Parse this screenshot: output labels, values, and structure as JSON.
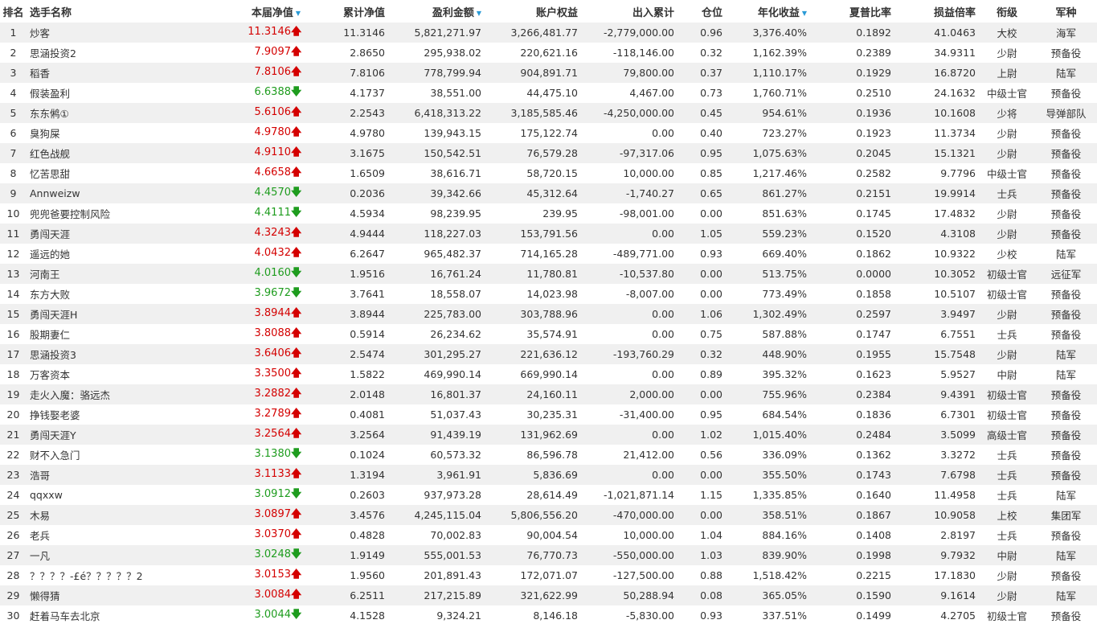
{
  "headers": {
    "rank": "排名",
    "name": "选手名称",
    "nav": "本届净值",
    "cum_nav": "累计净值",
    "profit": "盈利金额",
    "equity": "账户权益",
    "flow": "出入累计",
    "position": "仓位",
    "annual": "年化收益",
    "sharpe": "夏普比率",
    "pl_ratio": "损益倍率",
    "rank_title": "衔级",
    "branch": "军种"
  },
  "sort_indicator": "▼",
  "colors": {
    "up": "#d40000",
    "down": "#1e9c1e",
    "sort": "#2a9ad6",
    "stripe": "#f0f0f0"
  },
  "rows": [
    {
      "rank": "1",
      "name": "炒客",
      "nav": "11.3146",
      "dir": "up",
      "cum_nav": "11.3146",
      "profit": "5,821,271.97",
      "equity": "3,266,481.77",
      "flow": "-2,779,000.00",
      "position": "0.96",
      "annual": "3,376.40%",
      "sharpe": "0.1892",
      "pl_ratio": "41.0463",
      "title": "大校",
      "branch": "海军"
    },
    {
      "rank": "2",
      "name": "思涵投资2",
      "nav": "7.9097",
      "dir": "up",
      "cum_nav": "2.8650",
      "profit": "295,938.02",
      "equity": "220,621.16",
      "flow": "-118,146.00",
      "position": "0.32",
      "annual": "1,162.39%",
      "sharpe": "0.2389",
      "pl_ratio": "34.9311",
      "title": "少尉",
      "branch": "预备役"
    },
    {
      "rank": "3",
      "name": "稻香",
      "nav": "7.8106",
      "dir": "up",
      "cum_nav": "7.8106",
      "profit": "778,799.94",
      "equity": "904,891.71",
      "flow": "79,800.00",
      "position": "0.37",
      "annual": "1,110.17%",
      "sharpe": "0.1929",
      "pl_ratio": "16.8720",
      "title": "上尉",
      "branch": "陆军"
    },
    {
      "rank": "4",
      "name": "假装盈利",
      "nav": "6.6388",
      "dir": "down",
      "cum_nav": "4.1737",
      "profit": "38,551.00",
      "equity": "44,475.10",
      "flow": "4,467.00",
      "position": "0.73",
      "annual": "1,760.71%",
      "sharpe": "0.2510",
      "pl_ratio": "24.1632",
      "title": "中级士官",
      "branch": "预备役"
    },
    {
      "rank": "5",
      "name": "东东鸺①",
      "nav": "5.6106",
      "dir": "up",
      "cum_nav": "2.2543",
      "profit": "6,418,313.22",
      "equity": "3,185,585.46",
      "flow": "-4,250,000.00",
      "position": "0.45",
      "annual": "954.61%",
      "sharpe": "0.1936",
      "pl_ratio": "10.1608",
      "title": "少将",
      "branch": "导弹部队"
    },
    {
      "rank": "6",
      "name": "臭狗屎",
      "nav": "4.9780",
      "dir": "up",
      "cum_nav": "4.9780",
      "profit": "139,943.15",
      "equity": "175,122.74",
      "flow": "0.00",
      "position": "0.40",
      "annual": "723.27%",
      "sharpe": "0.1923",
      "pl_ratio": "11.3734",
      "title": "少尉",
      "branch": "预备役"
    },
    {
      "rank": "7",
      "name": "红色战舰",
      "nav": "4.9110",
      "dir": "up",
      "cum_nav": "3.1675",
      "profit": "150,542.51",
      "equity": "76,579.28",
      "flow": "-97,317.06",
      "position": "0.95",
      "annual": "1,075.63%",
      "sharpe": "0.2045",
      "pl_ratio": "15.1321",
      "title": "少尉",
      "branch": "预备役"
    },
    {
      "rank": "8",
      "name": "忆苦思甜",
      "nav": "4.6658",
      "dir": "up",
      "cum_nav": "1.6509",
      "profit": "38,616.71",
      "equity": "58,720.15",
      "flow": "10,000.00",
      "position": "0.85",
      "annual": "1,217.46%",
      "sharpe": "0.2582",
      "pl_ratio": "9.7796",
      "title": "中级士官",
      "branch": "预备役"
    },
    {
      "rank": "9",
      "name": "Annweizw",
      "nav": "4.4570",
      "dir": "down",
      "cum_nav": "0.2036",
      "profit": "39,342.66",
      "equity": "45,312.64",
      "flow": "-1,740.27",
      "position": "0.65",
      "annual": "861.27%",
      "sharpe": "0.2151",
      "pl_ratio": "19.9914",
      "title": "士兵",
      "branch": "预备役"
    },
    {
      "rank": "10",
      "name": "兜兜爸要控制风险",
      "nav": "4.4111",
      "dir": "down",
      "cum_nav": "4.5934",
      "profit": "98,239.95",
      "equity": "239.95",
      "flow": "-98,001.00",
      "position": "0.00",
      "annual": "851.63%",
      "sharpe": "0.1745",
      "pl_ratio": "17.4832",
      "title": "少尉",
      "branch": "预备役"
    },
    {
      "rank": "11",
      "name": "勇闯天涯",
      "nav": "4.3243",
      "dir": "up",
      "cum_nav": "4.9444",
      "profit": "118,227.03",
      "equity": "153,791.56",
      "flow": "0.00",
      "position": "1.05",
      "annual": "559.23%",
      "sharpe": "0.1520",
      "pl_ratio": "4.3108",
      "title": "少尉",
      "branch": "预备役"
    },
    {
      "rank": "12",
      "name": "遥远的她",
      "nav": "4.0432",
      "dir": "up",
      "cum_nav": "6.2647",
      "profit": "965,482.37",
      "equity": "714,165.28",
      "flow": "-489,771.00",
      "position": "0.93",
      "annual": "669.40%",
      "sharpe": "0.1862",
      "pl_ratio": "10.9322",
      "title": "少校",
      "branch": "陆军"
    },
    {
      "rank": "13",
      "name": "河南王",
      "nav": "4.0160",
      "dir": "down",
      "cum_nav": "1.9516",
      "profit": "16,761.24",
      "equity": "11,780.81",
      "flow": "-10,537.80",
      "position": "0.00",
      "annual": "513.75%",
      "sharpe": "0.0000",
      "pl_ratio": "10.3052",
      "title": "初级士官",
      "branch": "远征军"
    },
    {
      "rank": "14",
      "name": "东方大败",
      "nav": "3.9672",
      "dir": "down",
      "cum_nav": "3.7641",
      "profit": "18,558.07",
      "equity": "14,023.98",
      "flow": "-8,007.00",
      "position": "0.00",
      "annual": "773.49%",
      "sharpe": "0.1858",
      "pl_ratio": "10.5107",
      "title": "初级士官",
      "branch": "预备役"
    },
    {
      "rank": "15",
      "name": "勇闯天涯H",
      "nav": "3.8944",
      "dir": "up",
      "cum_nav": "3.8944",
      "profit": "225,783.00",
      "equity": "303,788.96",
      "flow": "0.00",
      "position": "1.06",
      "annual": "1,302.49%",
      "sharpe": "0.2597",
      "pl_ratio": "3.9497",
      "title": "少尉",
      "branch": "预备役"
    },
    {
      "rank": "16",
      "name": "股期妻仁",
      "nav": "3.8088",
      "dir": "up",
      "cum_nav": "0.5914",
      "profit": "26,234.62",
      "equity": "35,574.91",
      "flow": "0.00",
      "position": "0.75",
      "annual": "587.88%",
      "sharpe": "0.1747",
      "pl_ratio": "6.7551",
      "title": "士兵",
      "branch": "预备役"
    },
    {
      "rank": "17",
      "name": "思涵投资3",
      "nav": "3.6406",
      "dir": "up",
      "cum_nav": "2.5474",
      "profit": "301,295.27",
      "equity": "221,636.12",
      "flow": "-193,760.29",
      "position": "0.32",
      "annual": "448.90%",
      "sharpe": "0.1955",
      "pl_ratio": "15.7548",
      "title": "少尉",
      "branch": "陆军"
    },
    {
      "rank": "18",
      "name": "万客资本",
      "nav": "3.3500",
      "dir": "up",
      "cum_nav": "1.5822",
      "profit": "469,990.14",
      "equity": "669,990.14",
      "flow": "0.00",
      "position": "0.89",
      "annual": "395.32%",
      "sharpe": "0.1623",
      "pl_ratio": "5.9527",
      "title": "中尉",
      "branch": "陆军"
    },
    {
      "rank": "19",
      "name": "走火入魔：骆远杰",
      "nav": "3.2882",
      "dir": "up",
      "cum_nav": "2.0148",
      "profit": "16,801.37",
      "equity": "24,160.11",
      "flow": "2,000.00",
      "position": "0.00",
      "annual": "755.96%",
      "sharpe": "0.2384",
      "pl_ratio": "9.4391",
      "title": "初级士官",
      "branch": "预备役"
    },
    {
      "rank": "20",
      "name": "挣钱娶老婆",
      "nav": "3.2789",
      "dir": "up",
      "cum_nav": "0.4081",
      "profit": "51,037.43",
      "equity": "30,235.31",
      "flow": "-31,400.00",
      "position": "0.95",
      "annual": "684.54%",
      "sharpe": "0.1836",
      "pl_ratio": "6.7301",
      "title": "初级士官",
      "branch": "预备役"
    },
    {
      "rank": "21",
      "name": "勇闯天涯Y",
      "nav": "3.2564",
      "dir": "up",
      "cum_nav": "3.2564",
      "profit": "91,439.19",
      "equity": "131,962.69",
      "flow": "0.00",
      "position": "1.02",
      "annual": "1,015.40%",
      "sharpe": "0.2484",
      "pl_ratio": "3.5099",
      "title": "高级士官",
      "branch": "预备役"
    },
    {
      "rank": "22",
      "name": "财不入急门",
      "nav": "3.1380",
      "dir": "down",
      "cum_nav": "0.1024",
      "profit": "60,573.32",
      "equity": "86,596.78",
      "flow": "21,412.00",
      "position": "0.56",
      "annual": "336.09%",
      "sharpe": "0.1362",
      "pl_ratio": "3.3272",
      "title": "士兵",
      "branch": "预备役"
    },
    {
      "rank": "23",
      "name": "浩哥",
      "nav": "3.1133",
      "dir": "up",
      "cum_nav": "1.3194",
      "profit": "3,961.91",
      "equity": "5,836.69",
      "flow": "0.00",
      "position": "0.00",
      "annual": "355.50%",
      "sharpe": "0.1743",
      "pl_ratio": "7.6798",
      "title": "士兵",
      "branch": "预备役"
    },
    {
      "rank": "24",
      "name": "qqxxw",
      "nav": "3.0912",
      "dir": "down",
      "cum_nav": "0.2603",
      "profit": "937,973.28",
      "equity": "28,614.49",
      "flow": "-1,021,871.14",
      "position": "1.15",
      "annual": "1,335.85%",
      "sharpe": "0.1640",
      "pl_ratio": "11.4958",
      "title": "士兵",
      "branch": "陆军"
    },
    {
      "rank": "25",
      "name": "木易",
      "nav": "3.0897",
      "dir": "up",
      "cum_nav": "3.4576",
      "profit": "4,245,115.04",
      "equity": "5,806,556.20",
      "flow": "-470,000.00",
      "position": "0.00",
      "annual": "358.51%",
      "sharpe": "0.1867",
      "pl_ratio": "10.9058",
      "title": "上校",
      "branch": "集团军"
    },
    {
      "rank": "26",
      "name": "老兵",
      "nav": "3.0370",
      "dir": "up",
      "cum_nav": "0.4828",
      "profit": "70,002.83",
      "equity": "90,004.54",
      "flow": "10,000.00",
      "position": "1.04",
      "annual": "884.16%",
      "sharpe": "0.1408",
      "pl_ratio": "2.8197",
      "title": "士兵",
      "branch": "预备役"
    },
    {
      "rank": "27",
      "name": "一凡",
      "nav": "3.0248",
      "dir": "down",
      "cum_nav": "1.9149",
      "profit": "555,001.53",
      "equity": "76,770.73",
      "flow": "-550,000.00",
      "position": "1.03",
      "annual": "839.90%",
      "sharpe": "0.1998",
      "pl_ratio": "9.7932",
      "title": "中尉",
      "branch": "陆军"
    },
    {
      "rank": "28",
      "name": "？？？？-£é？？？？？2",
      "nav": "3.0153",
      "dir": "up",
      "cum_nav": "1.9560",
      "profit": "201,891.43",
      "equity": "172,071.07",
      "flow": "-127,500.00",
      "position": "0.88",
      "annual": "1,518.42%",
      "sharpe": "0.2215",
      "pl_ratio": "17.1830",
      "title": "少尉",
      "branch": "预备役"
    },
    {
      "rank": "29",
      "name": "懒得猜",
      "nav": "3.0084",
      "dir": "up",
      "cum_nav": "6.2511",
      "profit": "217,215.89",
      "equity": "321,622.99",
      "flow": "50,288.94",
      "position": "0.08",
      "annual": "365.05%",
      "sharpe": "0.1590",
      "pl_ratio": "9.1614",
      "title": "少尉",
      "branch": "陆军"
    },
    {
      "rank": "30",
      "name": "赶着马车去北京",
      "nav": "3.0044",
      "dir": "down",
      "cum_nav": "4.1528",
      "profit": "9,324.21",
      "equity": "8,146.18",
      "flow": "-5,830.00",
      "position": "0.93",
      "annual": "337.51%",
      "sharpe": "0.1499",
      "pl_ratio": "4.2705",
      "title": "初级士官",
      "branch": "预备役"
    }
  ]
}
